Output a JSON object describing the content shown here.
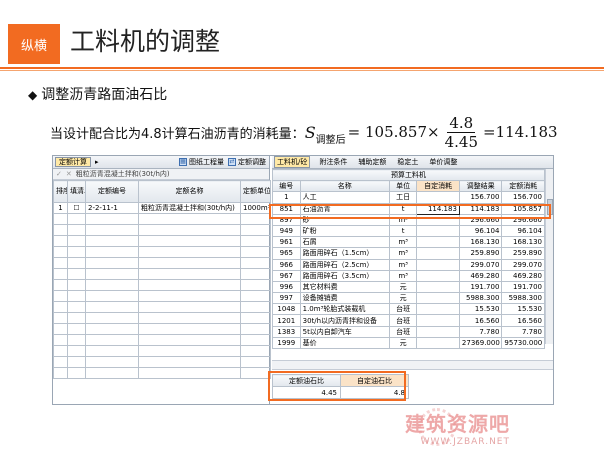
{
  "header": {
    "brand": "纵横",
    "title": "工料机的调整",
    "accent": "#f26b21"
  },
  "bullet": {
    "icon": "diamond-bullet-icon",
    "text": "调整沥青路面油石比"
  },
  "formula": {
    "lead": "当设计配合比为4.8计算石油沥青的消耗量：",
    "symbol": "S",
    "subscript": "调整后",
    "equals": "= 105.857×",
    "numerator": "4.8",
    "denominator": "4.45",
    "result": "=114.183"
  },
  "left": {
    "tabs": [
      "定额计算",
      "▸"
    ],
    "toolbar": [
      "图纸工程量",
      "定额调整"
    ],
    "crumb": "粗粒沥青混凝土拌和(30t/h内)",
    "columns": [
      "排序",
      "填清单量",
      "定额编号",
      "定额名称",
      "定额单位"
    ],
    "rows": [
      {
        "seq": "1",
        "check": "",
        "code": "2-2-11-1",
        "name": "粗粒沥青混凝土拌和(30t/h内)",
        "unit": "1000m³"
      }
    ]
  },
  "right": {
    "tabs": [
      "工料机/砼",
      "附注条件",
      "辅助定额",
      "稳定土",
      "单价调整"
    ],
    "group_header": "预算工料机",
    "columns": [
      "编号",
      "名称",
      "单位",
      "自定消耗",
      "调整结果",
      "定额消耗"
    ],
    "rows": [
      {
        "code": "1",
        "name": "人工",
        "unit": "工日",
        "custom": "",
        "result": "156.700",
        "quota": "156.700"
      },
      {
        "code": "851",
        "name": "石油沥青",
        "unit": "t",
        "custom": "114.183",
        "result": "114.183",
        "quota": "105.857"
      },
      {
        "code": "897",
        "name": "砂",
        "unit": "m³",
        "custom": "",
        "result": "296.660",
        "quota": "296.660"
      },
      {
        "code": "949",
        "name": "矿粉",
        "unit": "t",
        "custom": "",
        "result": "96.104",
        "quota": "96.104"
      },
      {
        "code": "961",
        "name": "石屑",
        "unit": "m³",
        "custom": "",
        "result": "168.130",
        "quota": "168.130"
      },
      {
        "code": "965",
        "name": "路面用碎石（1.5cm）",
        "unit": "m³",
        "custom": "",
        "result": "259.890",
        "quota": "259.890"
      },
      {
        "code": "966",
        "name": "路面用碎石（2.5cm）",
        "unit": "m³",
        "custom": "",
        "result": "299.070",
        "quota": "299.070"
      },
      {
        "code": "967",
        "name": "路面用碎石（3.5cm）",
        "unit": "m³",
        "custom": "",
        "result": "469.280",
        "quota": "469.280"
      },
      {
        "code": "996",
        "name": "其它材料费",
        "unit": "元",
        "custom": "",
        "result": "191.700",
        "quota": "191.700"
      },
      {
        "code": "997",
        "name": "设备摊销费",
        "unit": "元",
        "custom": "",
        "result": "5988.300",
        "quota": "5988.300"
      },
      {
        "code": "1048",
        "name": "1.0m³轮胎式装载机",
        "unit": "台班",
        "custom": "",
        "result": "15.530",
        "quota": "15.530"
      },
      {
        "code": "1201",
        "name": "30t/h以内沥青拌和设备",
        "unit": "台班",
        "custom": "",
        "result": "16.560",
        "quota": "16.560"
      },
      {
        "code": "1383",
        "name": "5t以内自卸汽车",
        "unit": "台班",
        "custom": "",
        "result": "7.780",
        "quota": "7.780"
      },
      {
        "code": "1999",
        "name": "基价",
        "unit": "元",
        "custom": "",
        "result": "27369.000",
        "quota": "95730.000"
      }
    ],
    "ratio": {
      "headers": [
        "定额油石比",
        "自定油石比"
      ],
      "values": [
        "4.45",
        "4.8"
      ]
    }
  },
  "watermark": {
    "text": "建筑资源吧",
    "url": "WWW.JZBAR.NET"
  }
}
